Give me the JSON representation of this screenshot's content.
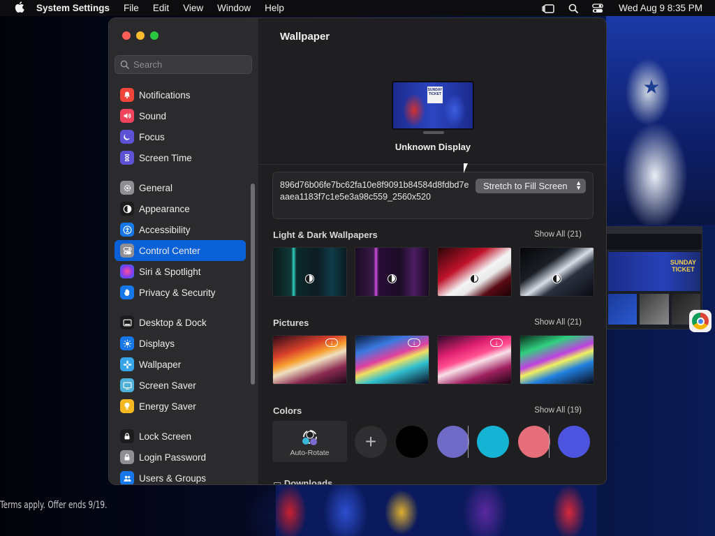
{
  "menubar": {
    "app_name": "System Settings",
    "menus": [
      "File",
      "Edit",
      "View",
      "Window",
      "Help"
    ],
    "clock": "Wed Aug 9  8:35 PM"
  },
  "sidebar": {
    "search_placeholder": "Search",
    "groups": [
      [
        {
          "label": "Notifications",
          "icon": "bell-icon",
          "color": "#f0453b"
        },
        {
          "label": "Sound",
          "icon": "speaker-icon",
          "color": "#f0445e"
        },
        {
          "label": "Focus",
          "icon": "moon-icon",
          "color": "#5d52d6"
        },
        {
          "label": "Screen Time",
          "icon": "hourglass-icon",
          "color": "#5d52d6"
        }
      ],
      [
        {
          "label": "General",
          "icon": "gear-icon",
          "color": "#8e8e93"
        },
        {
          "label": "Appearance",
          "icon": "appearance-icon",
          "color": "#1c1c1e"
        },
        {
          "label": "Accessibility",
          "icon": "accessibility-icon",
          "color": "#1677e8"
        },
        {
          "label": "Control Center",
          "icon": "control-center-icon",
          "color": "#8e8e93",
          "active": true
        },
        {
          "label": "Siri & Spotlight",
          "icon": "siri-icon",
          "color": "#c84bd6"
        },
        {
          "label": "Privacy & Security",
          "icon": "hand-icon",
          "color": "#1677e8"
        }
      ],
      [
        {
          "label": "Desktop & Dock",
          "icon": "dock-icon",
          "color": "#1c1c1e"
        },
        {
          "label": "Displays",
          "icon": "sun-icon",
          "color": "#1677e8"
        },
        {
          "label": "Wallpaper",
          "icon": "flower-icon",
          "color": "#37a6e8"
        },
        {
          "label": "Screen Saver",
          "icon": "screensaver-icon",
          "color": "#4fb0d9"
        },
        {
          "label": "Energy Saver",
          "icon": "bulb-icon",
          "color": "#f5b820"
        }
      ],
      [
        {
          "label": "Lock Screen",
          "icon": "lock-icon",
          "color": "#1c1c1e"
        },
        {
          "label": "Login Password",
          "icon": "lock-icon",
          "color": "#8e8e93"
        },
        {
          "label": "Users & Groups",
          "icon": "users-icon",
          "color": "#1677e8"
        }
      ]
    ]
  },
  "main": {
    "title": "Wallpaper",
    "display_name": "Unknown Display",
    "file_name": "896d76b06fe7bc62fa10e8f9091b84584d8fdbd7eaaea1183f7c1e5e3a98c559_2560x520",
    "fill_mode": "Stretch to Fill Screen",
    "sections": {
      "light_dark": {
        "title": "Light & Dark Wallpapers",
        "show_all": "Show All (21)"
      },
      "pictures": {
        "title": "Pictures",
        "show_all": "Show All (21)"
      },
      "colors": {
        "title": "Colors",
        "show_all": "Show All (19)"
      }
    },
    "auto_rotate_label": "Auto-Rotate",
    "swatches": [
      "#000000",
      "#6e6ac6",
      "#16b4d4",
      "#e66d7a",
      "#4c54e0"
    ],
    "downloads_label": "Downloads"
  },
  "desktop": {
    "terms_text": "Terms apply. Offer ends 9/19."
  }
}
